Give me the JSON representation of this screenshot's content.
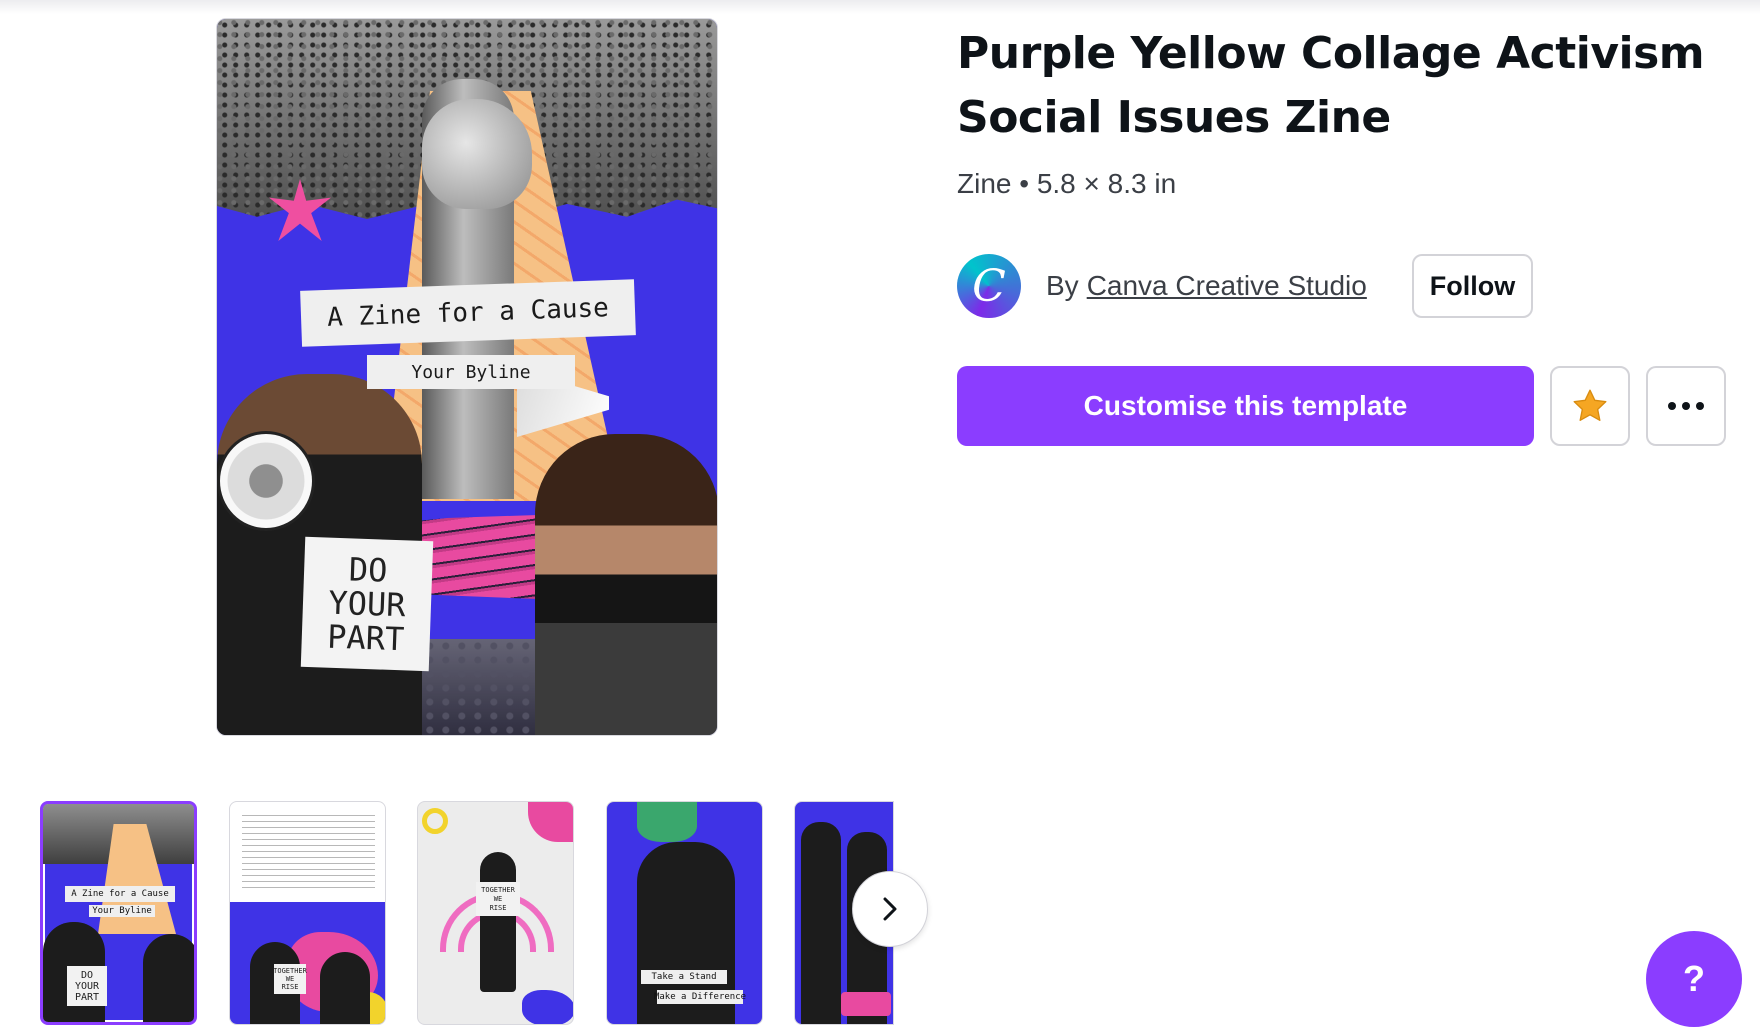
{
  "template": {
    "title": "Purple Yellow Collage Activism Social Issues Zine",
    "meta": "Zine • 5.8 × 8.3 in",
    "creator_prefix": "By",
    "creator_name": "Canva Creative Studio",
    "creator_initial": "C",
    "follow_label": "Follow"
  },
  "actions": {
    "customise_label": "Customise this template",
    "star_icon": "star-icon",
    "more_icon": "more-options-icon"
  },
  "preview": {
    "title_text": "A Zine for a Cause",
    "byline_text": "Your Byline",
    "sign_lines": [
      "DO",
      "YOUR",
      "PART"
    ]
  },
  "thumbnails": [
    {
      "page": 1,
      "selected": true,
      "title_text": "A Zine for a Cause",
      "byline_text": "Your Byline",
      "sign_lines": [
        "DO",
        "YOUR",
        "PART"
      ]
    },
    {
      "page": 2,
      "selected": false,
      "sign_lines": [
        "TOGETHER",
        "WE",
        "RISE"
      ]
    },
    {
      "page": 3,
      "selected": false,
      "sign_lines": [
        "TOGETHER",
        "WE",
        "RISE"
      ]
    },
    {
      "page": 4,
      "selected": false,
      "label_1": "Take a Stand",
      "label_2": "Make a Difference"
    },
    {
      "page": 5,
      "selected": false
    }
  ],
  "help_label": "?",
  "colors": {
    "brand_purple": "#8b3dff",
    "zine_blue": "#3f33e6",
    "zine_yellow": "#f6c185",
    "zine_pink": "#e84aa0",
    "star": "#f5a623"
  }
}
